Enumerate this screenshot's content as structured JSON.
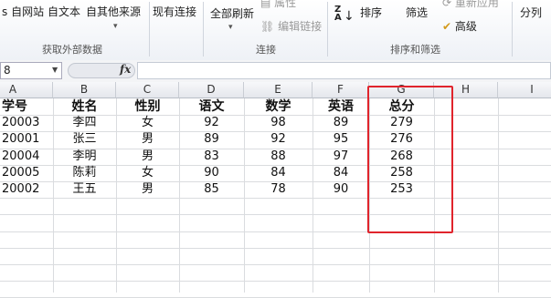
{
  "ribbon": {
    "items": {
      "from_web": "s 自网站",
      "from_text": "自文本",
      "from_other": "自其他来源",
      "existing": "现有连接",
      "refresh_all": "全部刷新",
      "properties": "属性",
      "edit_links": "编辑链接",
      "sort": "排序",
      "filter": "筛选",
      "reapply": "重新应用",
      "advanced": "高级",
      "text_to_columns": "分列"
    },
    "groups": {
      "get_external": "获取外部数据",
      "connections": "连接",
      "sort_filter": "排序和筛选"
    }
  },
  "formula_bar": {
    "name_box": "8",
    "fx": "fx",
    "value": ""
  },
  "sheet": {
    "columns": [
      "A",
      "B",
      "C",
      "D",
      "E",
      "F",
      "G",
      "H",
      "I"
    ],
    "header": [
      "学号",
      "姓名",
      "性别",
      "语文",
      "数学",
      "英语",
      "总分"
    ],
    "rows": [
      [
        "20003",
        "李四",
        "女",
        "92",
        "98",
        "89",
        "279"
      ],
      [
        "20001",
        "张三",
        "男",
        "89",
        "92",
        "95",
        "276"
      ],
      [
        "20004",
        "李明",
        "男",
        "83",
        "88",
        "97",
        "268"
      ],
      [
        "20005",
        "陈莉",
        "女",
        "90",
        "84",
        "84",
        "258"
      ],
      [
        "20002",
        "王五",
        "男",
        "85",
        "78",
        "90",
        "253"
      ]
    ]
  },
  "highlight_color": "#e0242c"
}
